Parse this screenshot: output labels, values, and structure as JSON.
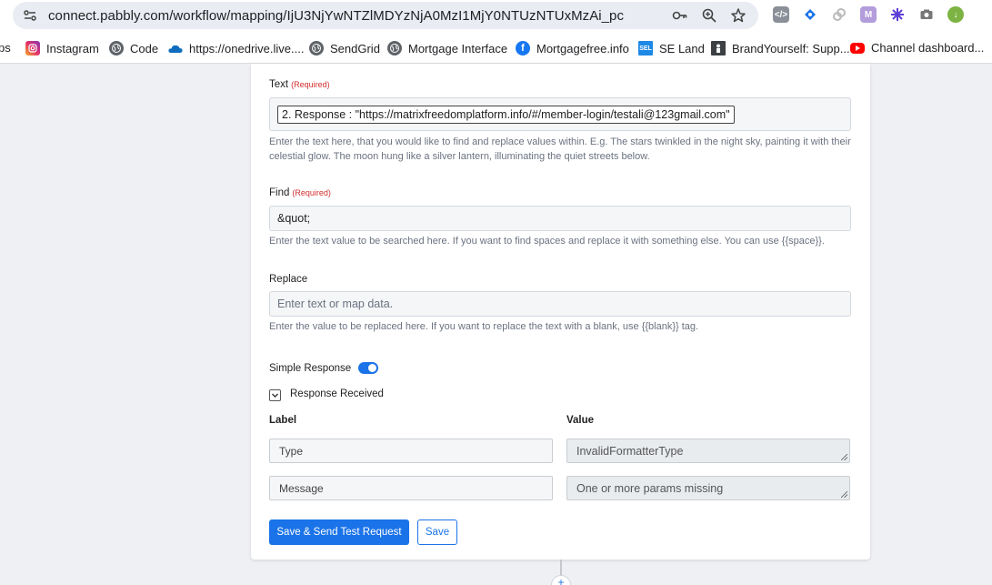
{
  "browser": {
    "url": "connect.pabbly.com/workflow/mapping/IjU3NjYwNTZlMDYzNjA0MzI1MjY0NTUzNTUxMzAi_pc",
    "bookmarks": [
      {
        "label": "ps",
        "icon": "apps-icon"
      },
      {
        "label": "Instagram",
        "icon": "instagram-icon",
        "color": "#e1306c"
      },
      {
        "label": "Code",
        "icon": "globe-icon"
      },
      {
        "label": "https://onedrive.live....",
        "icon": "onedrive-icon",
        "color": "#0f6cbd"
      },
      {
        "label": "SendGrid",
        "icon": "globe-icon"
      },
      {
        "label": "Mortgage Interface",
        "icon": "globe-icon"
      },
      {
        "label": "Mortgagefree.info",
        "icon": "facebook-icon",
        "color": "#1877f2"
      },
      {
        "label": "SE Land",
        "icon": "sel-icon",
        "badge": "SEL"
      },
      {
        "label": "BrandYourself: Supp...",
        "icon": "brandyourself-icon"
      },
      {
        "label": "Channel dashboard...",
        "icon": "youtube-icon",
        "color": "#ff0000"
      }
    ]
  },
  "form": {
    "text": {
      "label": "Text",
      "required": "(Required)",
      "value": "2. Response : \"https://matrixfreedomplatform.info/#/member-login/testali@123gmail.com\"",
      "help": "Enter the text here, that you would like to find and replace values within. E.g. The stars twinkled in the night sky, painting it with their celestial glow. The moon hung like a silver lantern, illuminating the quiet streets below."
    },
    "find": {
      "label": "Find",
      "required": "(Required)",
      "value": "&quot;",
      "help": "Enter the text value to be searched here. If you want to find spaces and replace it with something else. You can use {{space}}."
    },
    "replace": {
      "label": "Replace",
      "placeholder": "Enter text or map data.",
      "help": "Enter the value to be replaced here. If you want to replace the text with a blank, use {{blank}} tag."
    },
    "simple_response": {
      "label": "Simple Response",
      "enabled": true
    },
    "response_received": {
      "label": "Response Received",
      "expanded": true
    },
    "response_table": {
      "label_header": "Label",
      "value_header": "Value",
      "rows": [
        {
          "label": "Type",
          "value": "InvalidFormatterType"
        },
        {
          "label": "Message",
          "value": "One or more params missing"
        }
      ]
    },
    "buttons": {
      "send_test": "Save & Send Test Request",
      "save": "Save"
    }
  },
  "colors": {
    "accent": "#1a73e8",
    "required": "#d32f2f"
  }
}
